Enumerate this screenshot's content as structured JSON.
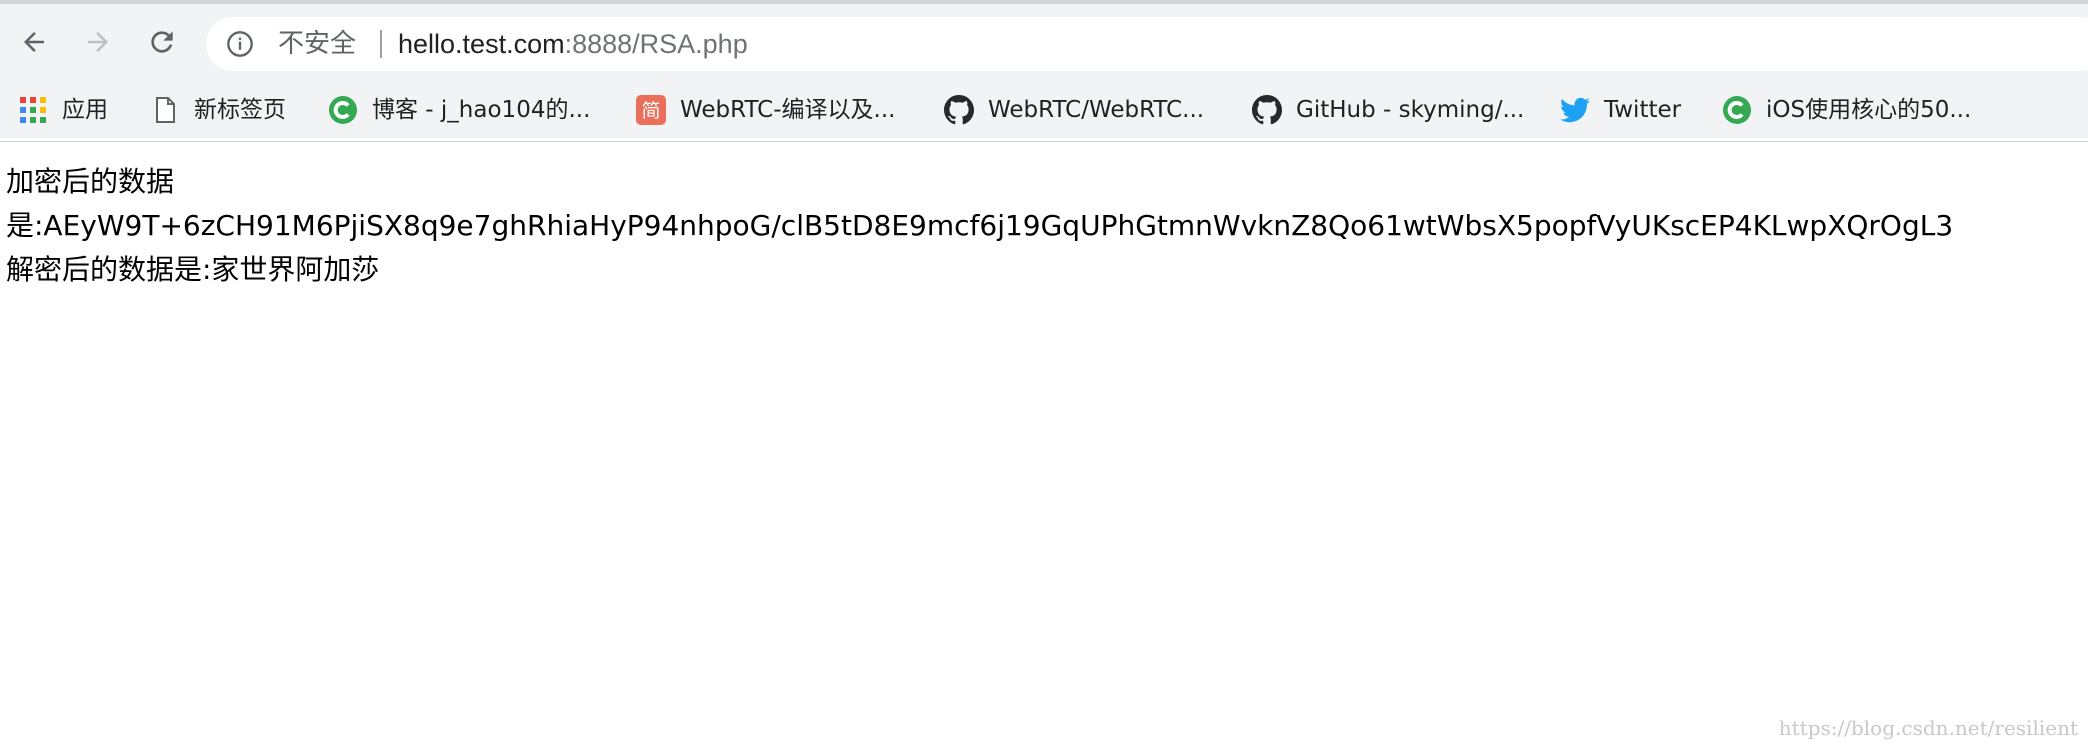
{
  "browser": {
    "address_bar": {
      "security_label": "不安全",
      "url_host": "hello.test.com",
      "url_rest": ":8888/RSA.php"
    },
    "bookmarks": [
      {
        "label": "应用",
        "icon": "apps-grid-icon"
      },
      {
        "label": "新标签页",
        "icon": "page-icon"
      },
      {
        "label": "博客 - j_hao104的...",
        "icon": "green-c-icon"
      },
      {
        "label": "WebRTC-编译以及...",
        "icon": "jianshu-icon"
      },
      {
        "label": "WebRTC/WebRTC...",
        "icon": "github-icon"
      },
      {
        "label": "GitHub - skyming/...",
        "icon": "github-icon"
      },
      {
        "label": "Twitter",
        "icon": "twitter-icon"
      },
      {
        "label": "iOS使用核心的50...",
        "icon": "green-c-icon"
      }
    ]
  },
  "content": {
    "line1": "加密后的数据",
    "line2": "是:AEyW9T+6zCH91M6PjiSX8q9e7ghRhiaHyP94nhpoG/clB5tD8E9mcf6j19GqUPhGtmnWvknZ8Qo61wtWbsX5popfVyUKscEP4KLwpXQrOgL3",
    "line3": "解密后的数据是:家世界阿加莎"
  },
  "watermark": "https://blog.csdn.net/resilient",
  "colors": {
    "toolbar_bg": "#f1f3f4",
    "omnibox_bg": "#ffffff",
    "text_secondary": "#5f6368",
    "google_green": "#34a853",
    "jianshu_red": "#ea6f5a",
    "twitter_blue": "#1da1f2"
  }
}
